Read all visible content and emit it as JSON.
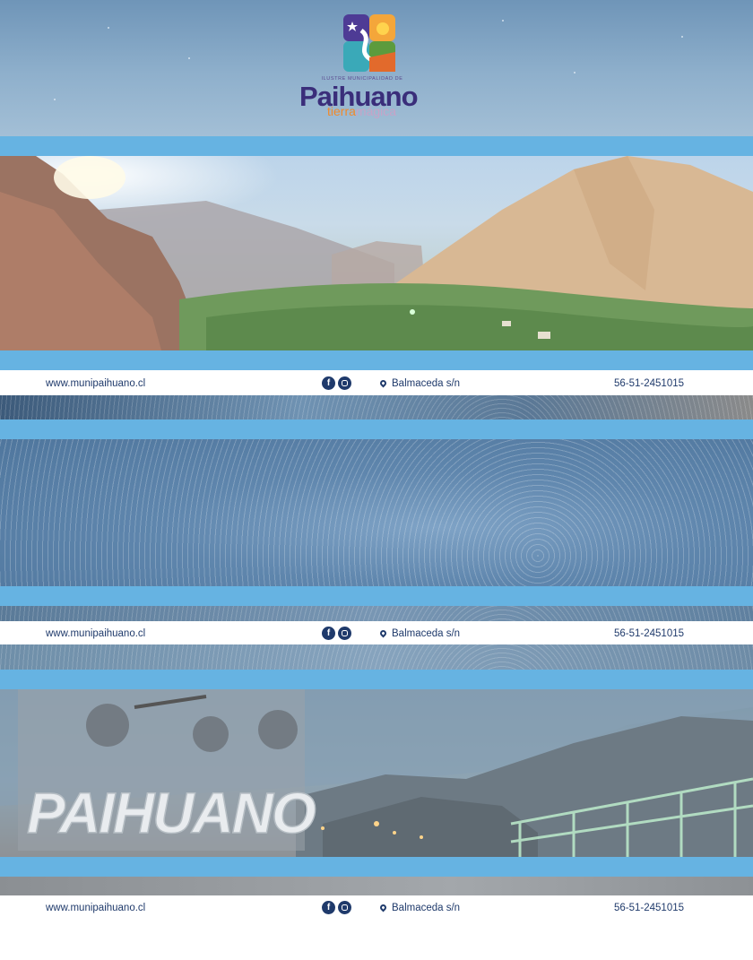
{
  "logo": {
    "small_text": "Ilustre Municipalidad de",
    "title": "Paihuano",
    "tagline_part1": "tierra",
    "tagline_part2": "mágica",
    "icon": "paihuano-logo-mark"
  },
  "sign": {
    "text": "PAIHUANO"
  },
  "footers": [
    {
      "website": "www.munipaihuano.cl",
      "facebook_icon": "f",
      "address": "Balmaceda s/n",
      "phone": "56-51-2451015"
    },
    {
      "website": "www.munipaihuano.cl",
      "facebook_icon": "f",
      "address": "Balmaceda s/n",
      "phone": "56-51-2451015"
    },
    {
      "website": "www.munipaihuano.cl",
      "facebook_icon": "f",
      "address": "Balmaceda s/n",
      "phone": "56-51-2451015"
    }
  ],
  "colors": {
    "band": "#66b3e2",
    "footer_text": "#1f3a6b",
    "logo_purple": "#3a2e7a",
    "logo_orange": "#f08a2c"
  }
}
